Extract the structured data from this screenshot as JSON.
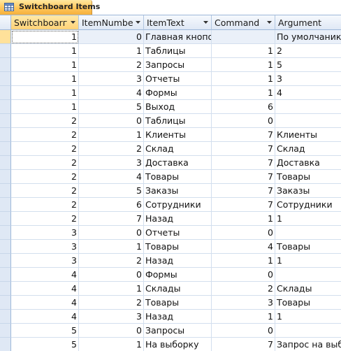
{
  "tab": {
    "label": "Switchboard Items",
    "icon": "table-icon"
  },
  "columns": [
    {
      "label": "SwitchboardID",
      "display": "Switchboarг",
      "align": "right"
    },
    {
      "label": "ItemNumber",
      "display": "ItemNumbe",
      "align": "right"
    },
    {
      "label": "ItemText",
      "display": "ItemText",
      "align": "left"
    },
    {
      "label": "Command",
      "display": "Command",
      "align": "right"
    },
    {
      "label": "Argument",
      "display": "Argument",
      "align": "left"
    }
  ],
  "rows": [
    [
      "1",
      "0",
      "Главная кнопо",
      "",
      "По умолчаник"
    ],
    [
      "1",
      "1",
      "Таблицы",
      "1",
      "2"
    ],
    [
      "1",
      "2",
      "Запросы",
      "1",
      "5"
    ],
    [
      "1",
      "3",
      "Отчеты",
      "1",
      "3"
    ],
    [
      "1",
      "4",
      "Формы",
      "1",
      "4"
    ],
    [
      "1",
      "5",
      "Выход",
      "6",
      ""
    ],
    [
      "2",
      "0",
      "Таблицы",
      "0",
      ""
    ],
    [
      "2",
      "1",
      "Клиенты",
      "7",
      "Клиенты"
    ],
    [
      "2",
      "2",
      "Склад",
      "7",
      "Склад"
    ],
    [
      "2",
      "3",
      "Доставка",
      "7",
      "Доставка"
    ],
    [
      "2",
      "4",
      "Товары",
      "7",
      "Товары"
    ],
    [
      "2",
      "5",
      "Заказы",
      "7",
      "Заказы"
    ],
    [
      "2",
      "6",
      "Сотрудники",
      "7",
      "Сотрудники"
    ],
    [
      "2",
      "7",
      "Назад",
      "1",
      "1"
    ],
    [
      "3",
      "0",
      "Отчеты",
      "0",
      ""
    ],
    [
      "3",
      "1",
      "Товары",
      "4",
      "Товары"
    ],
    [
      "3",
      "2",
      "Назад",
      "1",
      "1"
    ],
    [
      "4",
      "0",
      "Формы",
      "0",
      ""
    ],
    [
      "4",
      "1",
      "Склады",
      "2",
      "Склады"
    ],
    [
      "4",
      "2",
      "Товары",
      "3",
      "Товары"
    ],
    [
      "4",
      "3",
      "Назад",
      "1",
      "1"
    ],
    [
      "5",
      "0",
      "Запросы",
      "0",
      ""
    ],
    [
      "5",
      "1",
      "На выборку",
      "7",
      "Запрос на выб"
    ]
  ],
  "colors": {
    "tab_active": "#ffc65a",
    "header_bg": "#dfe8f5",
    "grid_line": "#d3dfee",
    "row_selected": "#eaf0f9"
  }
}
